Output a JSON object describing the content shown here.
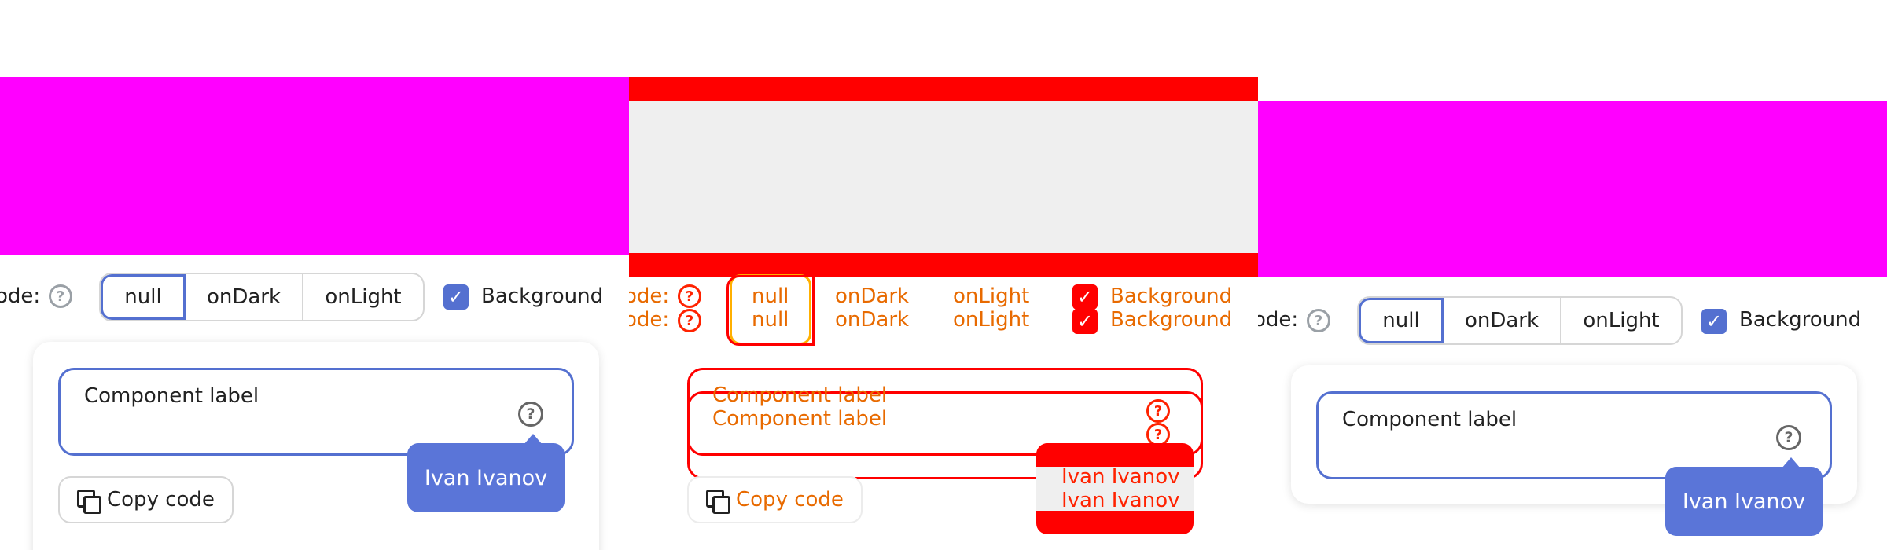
{
  "controls": {
    "label_partial": "ode:",
    "options": [
      "null",
      "onDark",
      "onLight"
    ],
    "active_option": "null",
    "background_label": "Background",
    "background_checked": true
  },
  "field": {
    "label": "Component label"
  },
  "tooltip": {
    "text": "Ivan Ivanov"
  },
  "copy_button": {
    "label": "Copy code"
  },
  "colors": {
    "accent": "#5470d0",
    "magenta": "#ff00ff",
    "debug_red": "#ff0000",
    "debug_orange": "#e86a00"
  },
  "icons": {
    "help": "question-circle-icon",
    "copy": "copy-icon",
    "check": "check-icon"
  }
}
